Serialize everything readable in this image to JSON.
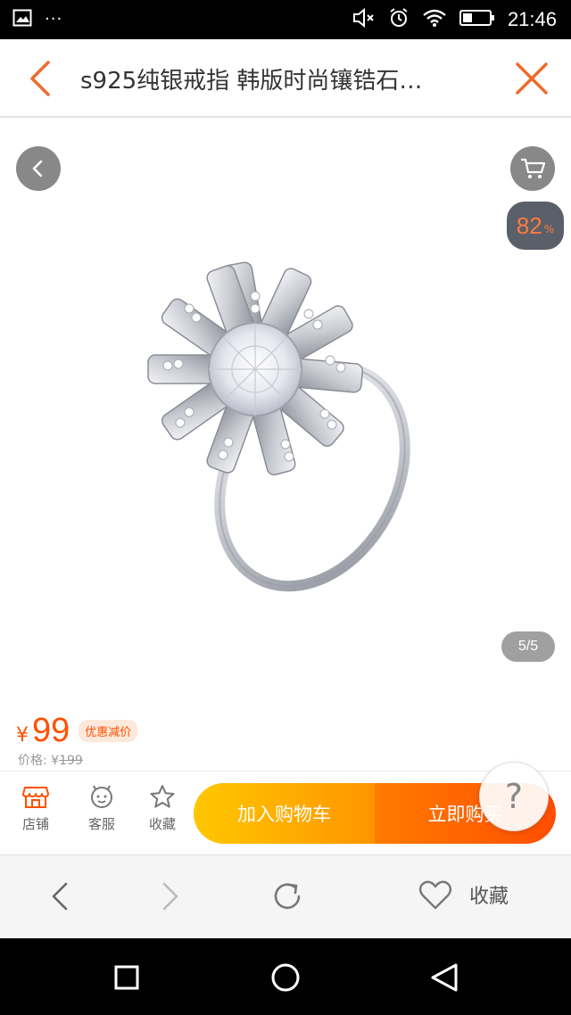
{
  "status_bar": {
    "time": "21:46",
    "left_extra": "···",
    "icons": [
      "image-icon",
      "mute-icon",
      "alarm-icon",
      "wifi-icon",
      "battery-icon"
    ]
  },
  "title_bar": {
    "title": "s925纯银戒指 韩版时尚镶锆石…",
    "back_icon": "chevron-left-icon",
    "close_icon": "close-icon",
    "accent_color": "#f06a2b"
  },
  "gallery": {
    "page_indicator": "5/5",
    "percent_value": "82",
    "percent_sign": "%"
  },
  "price": {
    "currency": "¥",
    "value": "99",
    "promo_tag": "优惠减价",
    "original_label": "价格: ¥",
    "original_value": "199",
    "accent_color": "#ff5000"
  },
  "action_bar": {
    "shop_label": "店铺",
    "service_label": "客服",
    "favorite_label": "收藏",
    "add_to_cart_label": "加入购物车",
    "buy_now_label": "立即购买",
    "help_symbol": "?"
  },
  "browser_nav": {
    "favorite_label": "收藏"
  }
}
